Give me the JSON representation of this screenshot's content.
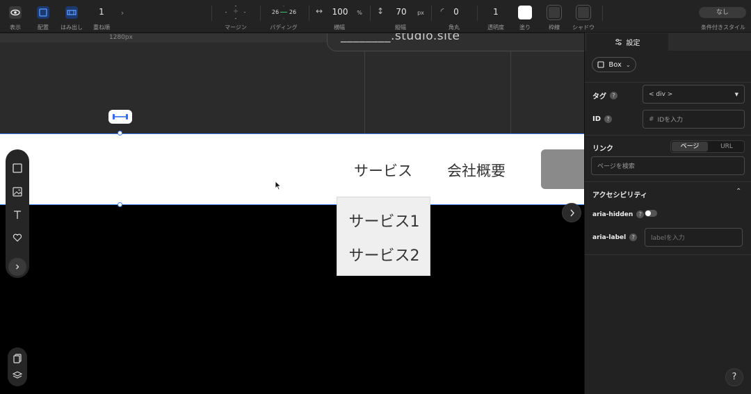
{
  "toolbar": {
    "view_label": "表示",
    "arrange_label": "配置",
    "overflow_label": "はみ出し",
    "zorder_value": "1",
    "zorder_label": "重ね順",
    "margin_label": "マージン",
    "margin_top": "-",
    "margin_left": "-",
    "margin_right": "-",
    "margin_bottom": "-",
    "padding_label": "パディング",
    "padding_left": "26",
    "padding_right": "26",
    "width_value": "100",
    "width_unit": "%",
    "width_label": "横幅",
    "height_value": "70",
    "height_unit": "px",
    "height_label": "縦幅",
    "radius_value": "0",
    "radius_label": "角丸",
    "opacity_value": "1",
    "opacity_label": "透明度",
    "fill_label": "塗り",
    "border_label": "枠線",
    "shadow_label": "シャドウ",
    "conditional_value": "なし",
    "conditional_label": "条件付きスタイル"
  },
  "canvas": {
    "ruler_label": "1280px",
    "url_text": "________.studio.site",
    "nav_service": "サービス",
    "nav_company": "会社概要",
    "dropdown_items": [
      "サービス1",
      "サービス2"
    ]
  },
  "panel": {
    "tab_settings": "設定",
    "component_type": "Box",
    "tag_label": "タグ",
    "tag_value": "< div >",
    "id_label": "ID",
    "id_placeholder": "IDを入力",
    "link_label": "リンク",
    "link_seg_page": "ページ",
    "link_seg_url": "URL",
    "link_search_placeholder": "ページを検索",
    "a11y_title": "アクセシビリティ",
    "aria_hidden_label": "aria-hidden",
    "aria_hidden_value": false,
    "aria_label_label": "aria-label",
    "aria_label_placeholder": "labelを入力",
    "help_fab": "?"
  },
  "colors": {
    "accent": "#3b7bf0",
    "fill_swatch": "#ffffff"
  }
}
